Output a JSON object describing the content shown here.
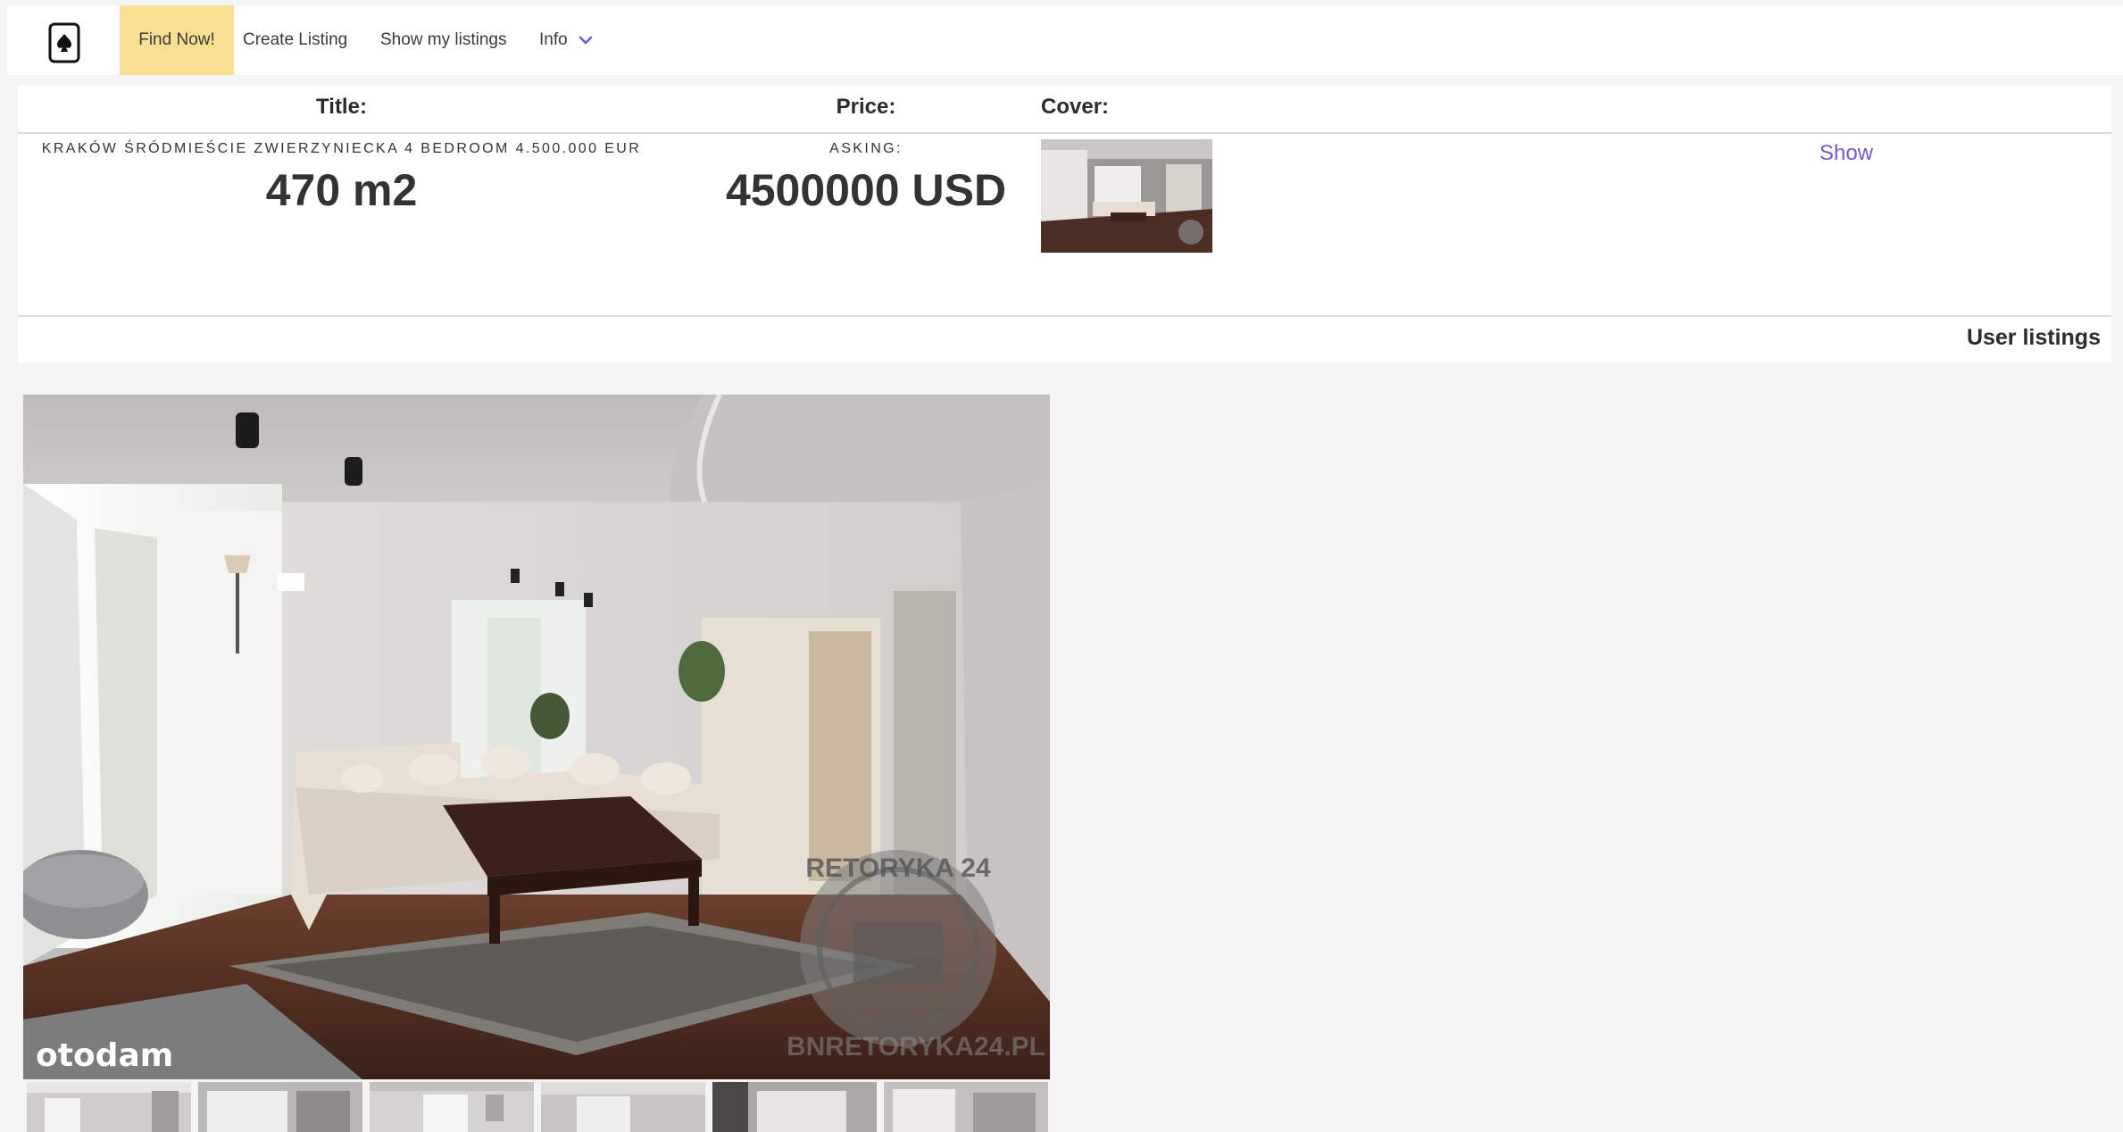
{
  "nav": {
    "logo_icon": "spade-card-icon",
    "items": [
      {
        "label": "Find Now!",
        "active": true
      },
      {
        "label": "Create Listing"
      },
      {
        "label": "Show my listings"
      },
      {
        "label": "Info"
      }
    ],
    "info_icon": "chevron-down-icon",
    "accent": "#f9df94",
    "link_color": "#6a5bd6"
  },
  "listing_table": {
    "headers": {
      "title": "Title:",
      "price": "Price:",
      "cover": "Cover:"
    },
    "row": {
      "title_small": "KRAKÓW ŚRÓDMIEŚCIE ZWIERZYNIECKA 4 BEDROOM 4.500.000 EUR",
      "title_big": "470 m2",
      "price_small": "ASKING:",
      "price_big": "4500000 USD",
      "cover_icon": "apartment-photo-thumbnail",
      "show_label": "Show"
    },
    "footer": "User listings"
  },
  "gallery": {
    "main_photo": {
      "icon": "living-room-photo",
      "watermark_left": "otodam",
      "watermark_right": "BNRETORYKA24.PL",
      "stamp": "RETORYKA 24"
    },
    "thumbnails": [
      {
        "icon": "room-thumbnail"
      },
      {
        "icon": "room-thumbnail"
      },
      {
        "icon": "room-thumbnail"
      },
      {
        "icon": "room-thumbnail"
      },
      {
        "icon": "room-thumbnail"
      },
      {
        "icon": "room-thumbnail"
      }
    ]
  }
}
